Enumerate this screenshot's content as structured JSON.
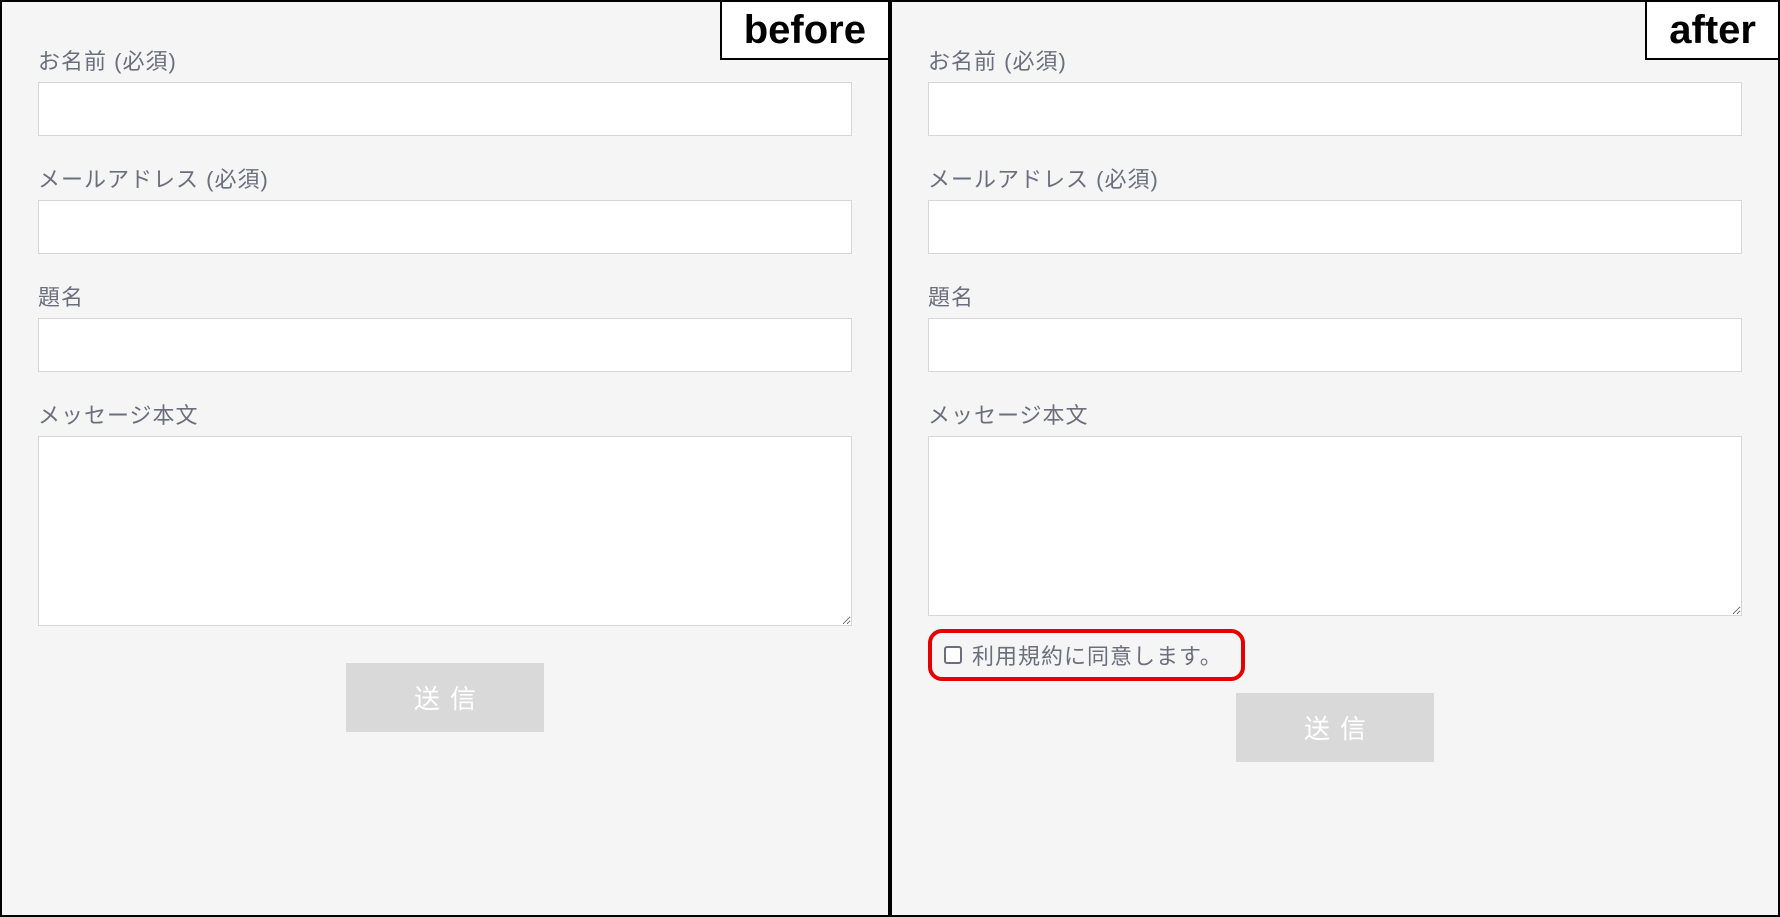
{
  "panels": {
    "before": {
      "tag": "before",
      "fields": {
        "name_label": "お名前 (必須)",
        "email_label": "メールアドレス (必須)",
        "subject_label": "題名",
        "message_label": "メッセージ本文"
      },
      "submit_label": "送信"
    },
    "after": {
      "tag": "after",
      "fields": {
        "name_label": "お名前 (必須)",
        "email_label": "メールアドレス (必須)",
        "subject_label": "題名",
        "message_label": "メッセージ本文"
      },
      "acceptance_label": "利用規約に同意します。",
      "submit_label": "送信"
    }
  }
}
